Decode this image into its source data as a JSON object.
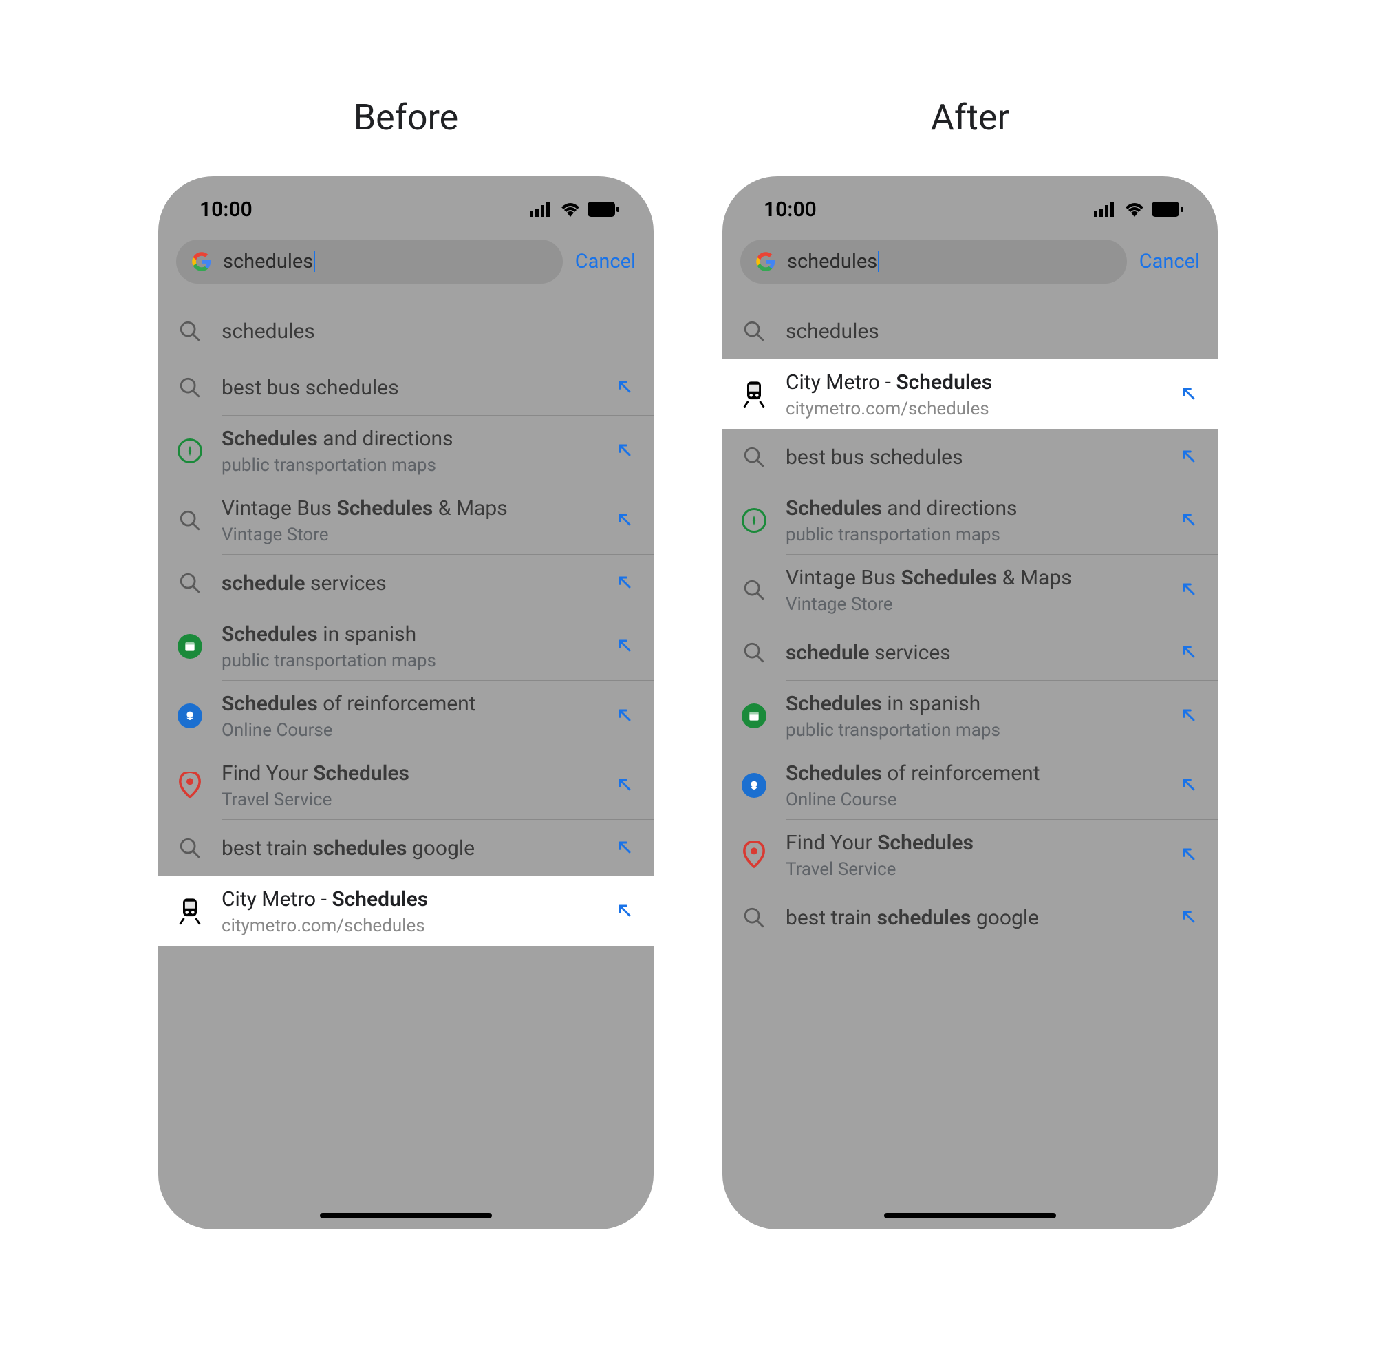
{
  "columns": {
    "before": {
      "title": "Before"
    },
    "after": {
      "title": "After"
    }
  },
  "status": {
    "time": "10:00"
  },
  "search": {
    "value": "schedules",
    "cancel": "Cancel"
  },
  "suggestions_before": [
    {
      "icon": "search",
      "title_parts": [
        {
          "t": "schedules",
          "b": false
        }
      ],
      "subtitle": "",
      "arrow": false,
      "highlighted": false
    },
    {
      "icon": "search",
      "title_parts": [
        {
          "t": "best bus schedules",
          "b": false
        }
      ],
      "subtitle": "",
      "arrow": true,
      "highlighted": false
    },
    {
      "icon": "compass",
      "title_parts": [
        {
          "t": "Schedules",
          "b": true
        },
        {
          "t": " and directions",
          "b": false
        }
      ],
      "subtitle": "public transportation maps",
      "arrow": true,
      "highlighted": false
    },
    {
      "icon": "search",
      "title_parts": [
        {
          "t": "Vintage Bus ",
          "b": false
        },
        {
          "t": "Schedules",
          "b": true
        },
        {
          "t": " & Maps",
          "b": false
        }
      ],
      "subtitle": "Vintage Store",
      "arrow": true,
      "highlighted": false
    },
    {
      "icon": "search",
      "title_parts": [
        {
          "t": "schedule",
          "b": true
        },
        {
          "t": " services",
          "b": false
        }
      ],
      "subtitle": "",
      "arrow": true,
      "highlighted": false
    },
    {
      "icon": "calendar",
      "title_parts": [
        {
          "t": "Schedules",
          "b": true
        },
        {
          "t": " in spanish",
          "b": false
        }
      ],
      "subtitle": "public transportation maps",
      "arrow": true,
      "highlighted": false
    },
    {
      "icon": "brain",
      "title_parts": [
        {
          "t": "Schedules",
          "b": true
        },
        {
          "t": " of reinforcement",
          "b": false
        }
      ],
      "subtitle": "Online Course",
      "arrow": true,
      "highlighted": false
    },
    {
      "icon": "pin",
      "title_parts": [
        {
          "t": "Find Your ",
          "b": false
        },
        {
          "t": "Schedules",
          "b": true
        }
      ],
      "subtitle": "Travel Service",
      "arrow": true,
      "highlighted": false
    },
    {
      "icon": "search",
      "title_parts": [
        {
          "t": "best train ",
          "b": false
        },
        {
          "t": "schedules",
          "b": true
        },
        {
          "t": " google",
          "b": false
        }
      ],
      "subtitle": "",
      "arrow": true,
      "highlighted": false
    },
    {
      "icon": "train",
      "title_parts": [
        {
          "t": "City Metro -  ",
          "b": false
        },
        {
          "t": "Schedules",
          "b": true
        }
      ],
      "subtitle": "citymetro.com/schedules",
      "arrow": true,
      "highlighted": true
    }
  ],
  "suggestions_after": [
    {
      "icon": "search",
      "title_parts": [
        {
          "t": "schedules",
          "b": false
        }
      ],
      "subtitle": "",
      "arrow": false,
      "highlighted": false
    },
    {
      "icon": "train",
      "title_parts": [
        {
          "t": "City Metro -  ",
          "b": false
        },
        {
          "t": "Schedules",
          "b": true
        }
      ],
      "subtitle": "citymetro.com/schedules",
      "arrow": true,
      "highlighted": true
    },
    {
      "icon": "search",
      "title_parts": [
        {
          "t": "best bus schedules",
          "b": false
        }
      ],
      "subtitle": "",
      "arrow": true,
      "highlighted": false
    },
    {
      "icon": "compass",
      "title_parts": [
        {
          "t": "Schedules",
          "b": true
        },
        {
          "t": " and directions",
          "b": false
        }
      ],
      "subtitle": "public transportation maps",
      "arrow": true,
      "highlighted": false
    },
    {
      "icon": "search",
      "title_parts": [
        {
          "t": "Vintage Bus ",
          "b": false
        },
        {
          "t": "Schedules",
          "b": true
        },
        {
          "t": " & Maps",
          "b": false
        }
      ],
      "subtitle": "Vintage Store",
      "arrow": true,
      "highlighted": false
    },
    {
      "icon": "search",
      "title_parts": [
        {
          "t": "schedule",
          "b": true
        },
        {
          "t": " services",
          "b": false
        }
      ],
      "subtitle": "",
      "arrow": true,
      "highlighted": false
    },
    {
      "icon": "calendar",
      "title_parts": [
        {
          "t": "Schedules",
          "b": true
        },
        {
          "t": " in spanish",
          "b": false
        }
      ],
      "subtitle": "public transportation maps",
      "arrow": true,
      "highlighted": false
    },
    {
      "icon": "brain",
      "title_parts": [
        {
          "t": "Schedules",
          "b": true
        },
        {
          "t": " of reinforcement",
          "b": false
        }
      ],
      "subtitle": "Online Course",
      "arrow": true,
      "highlighted": false
    },
    {
      "icon": "pin",
      "title_parts": [
        {
          "t": "Find Your ",
          "b": false
        },
        {
          "t": "Schedules",
          "b": true
        }
      ],
      "subtitle": "Travel Service",
      "arrow": true,
      "highlighted": false
    },
    {
      "icon": "search",
      "title_parts": [
        {
          "t": "best train ",
          "b": false
        },
        {
          "t": "schedules",
          "b": true
        },
        {
          "t": " google",
          "b": false
        }
      ],
      "subtitle": "",
      "arrow": true,
      "highlighted": false
    }
  ],
  "colors": {
    "link_blue": "#1a73e8",
    "green": "#1a8a3a",
    "blue_circle": "#1b6fd0",
    "red": "#d93a32"
  }
}
